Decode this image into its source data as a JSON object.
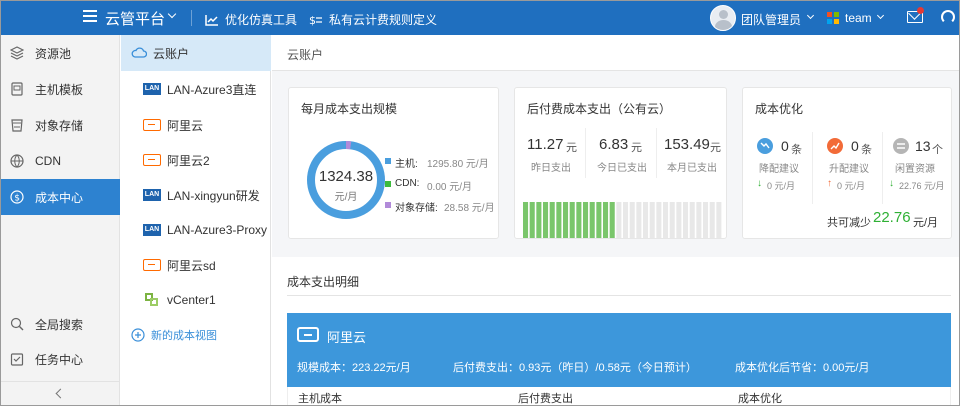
{
  "topbar": {
    "title": "云管平台",
    "link1": "优化仿真工具",
    "link2": "私有云计费规则定义",
    "user": "团队管理员",
    "team": "team"
  },
  "colors": {
    "primary": "#1f6fbf",
    "active": "#2d82d0",
    "green": "#2fb034",
    "orange": "#f26b38",
    "gray": "#b5b5b5",
    "ring": "#4a9ede",
    "cdn": "#3dbb3d",
    "storage": "#b18ad9"
  },
  "nav": {
    "items": [
      {
        "label": "资源池",
        "icon": "layers-icon"
      },
      {
        "label": "主机模板",
        "icon": "host-icon"
      },
      {
        "label": "对象存储",
        "icon": "bucket-icon"
      },
      {
        "label": "CDN",
        "icon": "globe-icon"
      },
      {
        "label": "成本中心",
        "icon": "dollar-icon"
      }
    ],
    "bottom": [
      {
        "label": "全局搜索",
        "icon": "search-icon"
      },
      {
        "label": "任务中心",
        "icon": "task-icon"
      }
    ]
  },
  "accounts": {
    "header": "云账户",
    "items": [
      {
        "label": "LAN-Azure3直连",
        "icon": "azure-icon"
      },
      {
        "label": "阿里云",
        "icon": "aliyun-icon"
      },
      {
        "label": "阿里云2",
        "icon": "aliyun-icon"
      },
      {
        "label": "LAN-xingyun研发",
        "icon": "azure-icon"
      },
      {
        "label": "LAN-Azure3-Proxy",
        "icon": "azure-icon"
      },
      {
        "label": "阿里云sd",
        "icon": "aliyun-icon"
      },
      {
        "label": "vCenter1",
        "icon": "vcenter-icon"
      }
    ],
    "add": "新的成本视图"
  },
  "breadcrumb": "云账户",
  "monthly": {
    "title": "每月成本支出规模",
    "total": "1324.38",
    "unit": "元/月",
    "items": [
      {
        "label": "主机:",
        "value": "1295.80 元/月",
        "amount": 1295.8
      },
      {
        "label": "CDN:",
        "value": "0.00 元/月",
        "amount": 0
      },
      {
        "label": "对象存储:",
        "value": "28.58 元/月",
        "amount": 28.58
      }
    ]
  },
  "postpaid": {
    "title": "后付费成本支出（公有云）",
    "stats": [
      {
        "value": "11.27",
        "unit": "元",
        "label": "昨日支出"
      },
      {
        "value": "6.83",
        "unit": "元",
        "label": "今日已支出"
      },
      {
        "value": "153.49",
        "unit": "元",
        "label": "本月已支出"
      }
    ],
    "bars_total": 30,
    "bars_filled": 14
  },
  "optimize": {
    "title": "成本优化",
    "items": [
      {
        "count": "0",
        "unit": "条",
        "label": "降配建议",
        "amount": "0 元/月",
        "icon": "trend-down-icon"
      },
      {
        "count": "0",
        "unit": "条",
        "label": "升配建议",
        "amount": "0 元/月",
        "icon": "trend-up-icon"
      },
      {
        "count": "13",
        "unit": "个",
        "label": "闲置资源",
        "amount": "22.76 元/月",
        "icon": "idle-icon"
      }
    ],
    "total_prefix": "共可减少",
    "total_value": "22.76",
    "total_unit": "元/月"
  },
  "detail": {
    "title": "成本支出明细",
    "provider": "阿里云",
    "stats": [
      "规模成本：223.22元/月",
      "后付费支出：0.93元（昨日）/0.58元（今日预计）",
      "成本优化后节省：0.00元/月"
    ],
    "columns": [
      "主机成本",
      "后付费支出",
      "成本优化"
    ]
  }
}
